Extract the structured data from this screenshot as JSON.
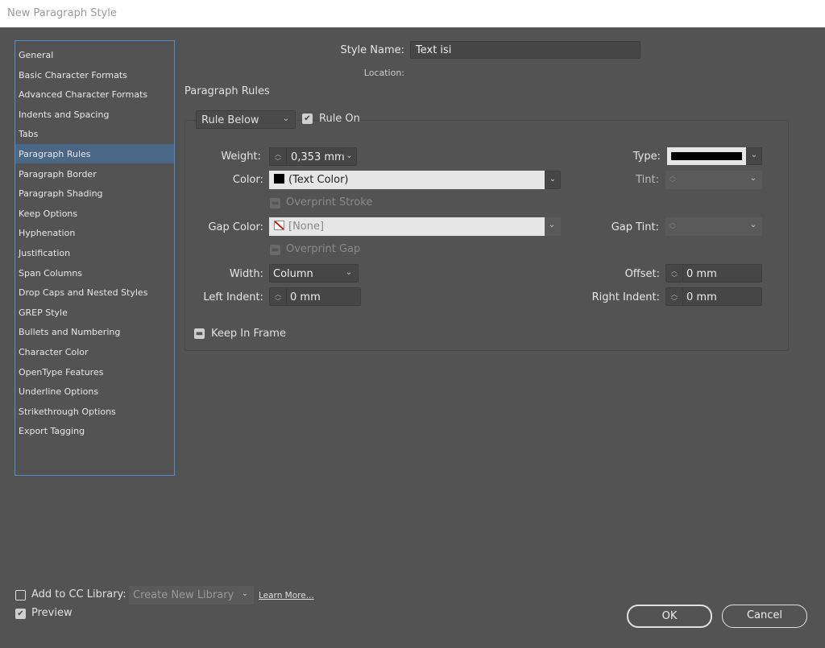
{
  "window": {
    "title": "New Paragraph Style"
  },
  "sidebar": {
    "selected": "Paragraph Rules",
    "items": [
      "General",
      "Basic Character Formats",
      "Advanced Character Formats",
      "Indents and Spacing",
      "Tabs",
      "Paragraph Rules",
      "Paragraph Border",
      "Paragraph Shading",
      "Keep Options",
      "Hyphenation",
      "Justification",
      "Span Columns",
      "Drop Caps and Nested Styles",
      "GREP Style",
      "Bullets and Numbering",
      "Character Color",
      "OpenType Features",
      "Underline Options",
      "Strikethrough Options",
      "Export Tagging"
    ]
  },
  "header": {
    "style_name_label": "Style Name:",
    "style_name_value": "Text isi",
    "location_label": "Location:",
    "section_title": "Paragraph Rules"
  },
  "rules": {
    "rule_select": "Rule Below",
    "rule_on_label": "Rule On",
    "rule_on_checked": true,
    "weight_label": "Weight:",
    "weight_value": "0,353 mm",
    "type_label": "Type:",
    "color_label": "Color:",
    "color_value": "(Text Color)",
    "tint_label": "Tint:",
    "overprint_stroke_label": "Overprint Stroke",
    "gap_color_label": "Gap Color:",
    "gap_color_value": "[None]",
    "gap_tint_label": "Gap Tint:",
    "overprint_gap_label": "Overprint Gap",
    "width_label": "Width:",
    "width_value": "Column",
    "offset_label": "Offset:",
    "offset_value": "0 mm",
    "left_indent_label": "Left Indent:",
    "left_indent_value": "0 mm",
    "right_indent_label": "Right Indent:",
    "right_indent_value": "0 mm",
    "keep_in_frame_label": "Keep In Frame"
  },
  "footer": {
    "add_cc_label": "Add to CC Library:",
    "add_cc_checked": false,
    "library_select": "Create New Library",
    "learn_more": "Learn More...",
    "preview_label": "Preview",
    "preview_checked": true,
    "ok": "OK",
    "cancel": "Cancel"
  },
  "colors": {
    "selected_item": "#4a6785",
    "panel": "#535353",
    "focus_border": "#4f8fd0"
  }
}
